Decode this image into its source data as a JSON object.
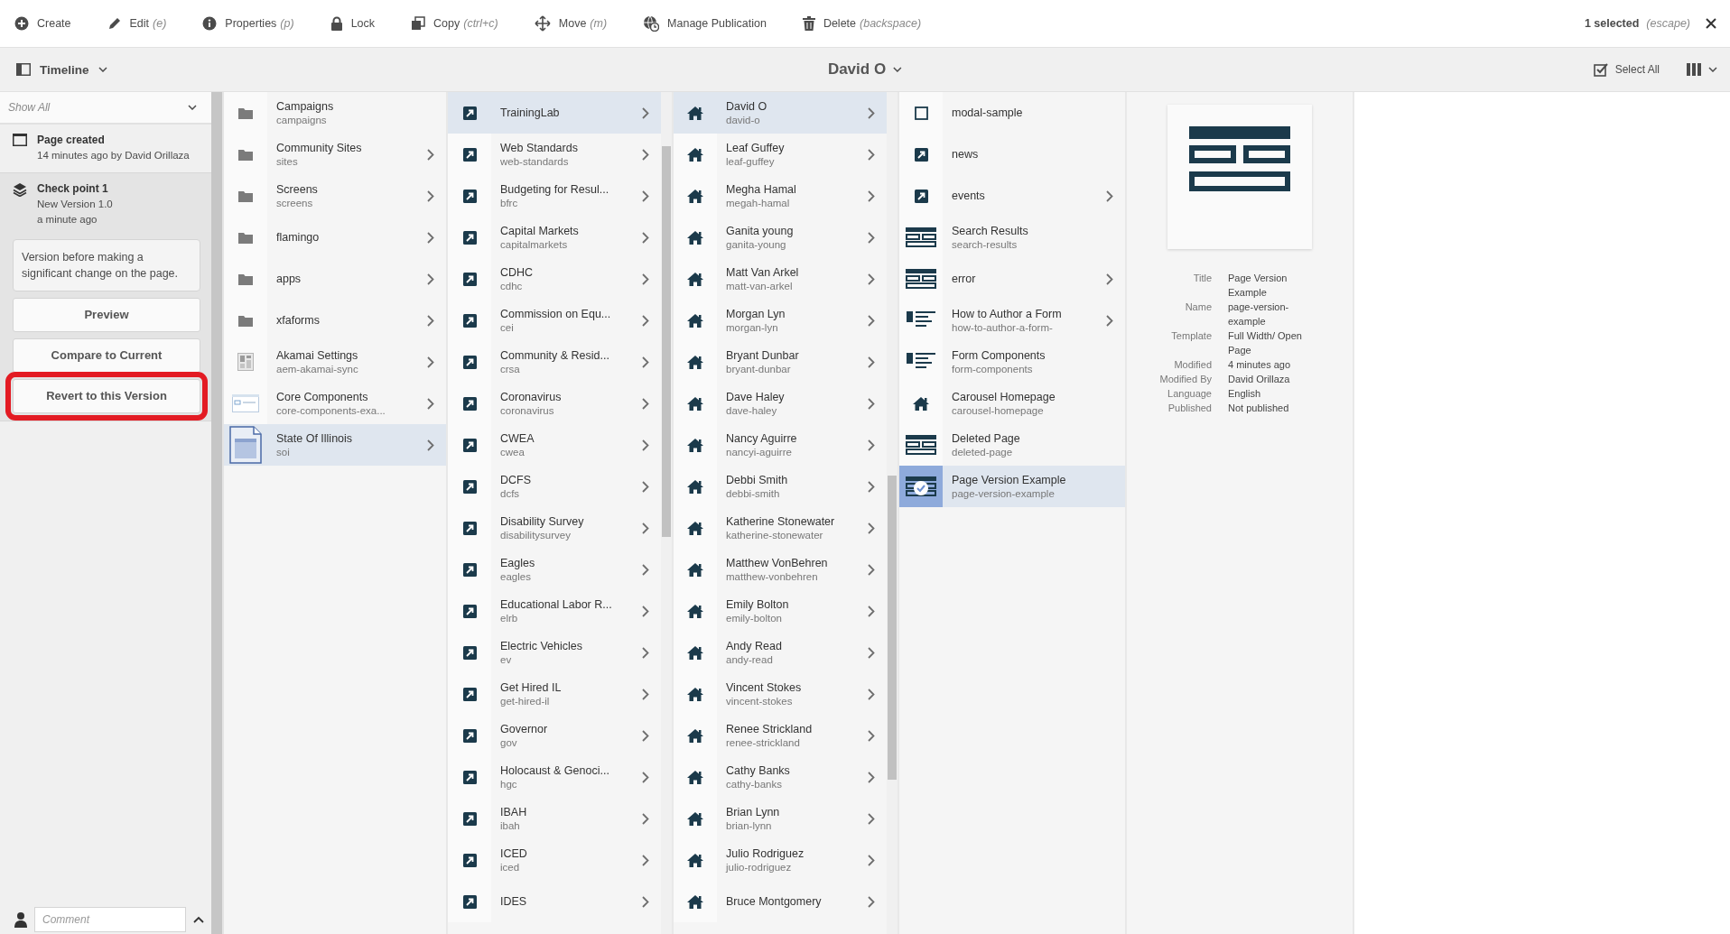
{
  "toolbar": {
    "actions": [
      {
        "kind": "create",
        "label": "Create"
      },
      {
        "kind": "edit",
        "label": "Edit",
        "shortcut": "(e)"
      },
      {
        "kind": "properties",
        "label": "Properties",
        "shortcut": "(p)"
      },
      {
        "kind": "lock",
        "label": "Lock"
      },
      {
        "kind": "copy",
        "label": "Copy",
        "shortcut": "(ctrl+c)"
      },
      {
        "kind": "move",
        "label": "Move",
        "shortcut": "(m)"
      },
      {
        "kind": "publication",
        "label": "Manage Publication"
      },
      {
        "kind": "delete",
        "label": "Delete",
        "shortcut": "(backspace)"
      }
    ],
    "selection": {
      "count": "1 selected",
      "shortcut": "(escape)"
    }
  },
  "subbar": {
    "rail": "Timeline",
    "title": "David O",
    "select_all": "Select All"
  },
  "timeline": {
    "filter": "Show All",
    "entries": [
      {
        "kind": "created",
        "title": "Page created",
        "lines": [
          "14 minutes ago by David Orillaza"
        ],
        "expanded": false
      },
      {
        "kind": "version",
        "title": "Check point 1",
        "lines": [
          "New Version 1.0",
          "a minute ago"
        ],
        "expanded": true,
        "comment": "Version before making a significant change on the page.",
        "actions": [
          {
            "label": "Preview",
            "highlighted": false
          },
          {
            "label": "Compare to Current",
            "highlighted": false
          },
          {
            "label": "Revert to this Version",
            "highlighted": true
          }
        ]
      }
    ],
    "comment_field": {
      "placeholder": "Comment"
    }
  },
  "columns": [
    {
      "items": [
        {
          "kind": "folder",
          "title": "Campaigns",
          "name": "campaigns",
          "has_children": false,
          "selected": false,
          "checked": false
        },
        {
          "kind": "folder",
          "title": "Community Sites",
          "name": "sites",
          "has_children": true,
          "selected": false,
          "checked": false
        },
        {
          "kind": "folder",
          "title": "Screens",
          "name": "screens",
          "has_children": true,
          "selected": false,
          "checked": false
        },
        {
          "kind": "folder",
          "title": "flamingo",
          "has_children": true,
          "selected": false,
          "checked": false
        },
        {
          "kind": "folder",
          "title": "apps",
          "has_children": true,
          "selected": false,
          "checked": false
        },
        {
          "kind": "folder",
          "title": "xfaforms",
          "has_children": true,
          "selected": false,
          "checked": false
        },
        {
          "kind": "settings",
          "title": "Akamai Settings",
          "name": "aem-akamai-sync",
          "has_children": true,
          "selected": false,
          "checked": false
        },
        {
          "kind": "card",
          "title": "Core Components",
          "name": "core-components-exa...",
          "has_children": true,
          "selected": false,
          "checked": false
        },
        {
          "kind": "page",
          "title": "State Of Illinois",
          "name": "soi",
          "has_children": true,
          "selected": true,
          "checked": false
        }
      ]
    },
    {
      "items": [
        {
          "kind": "link",
          "title": "TrainingLab",
          "has_children": true,
          "selected": true,
          "checked": false
        },
        {
          "kind": "link",
          "title": "Web Standards",
          "name": "web-standards",
          "has_children": true,
          "selected": false,
          "checked": false
        },
        {
          "kind": "link",
          "title": "Budgeting for Resul...",
          "name": "bfrc",
          "has_children": true,
          "selected": false,
          "checked": false
        },
        {
          "kind": "link",
          "title": "Capital Markets",
          "name": "capitalmarkets",
          "has_children": true,
          "selected": false,
          "checked": false
        },
        {
          "kind": "link",
          "title": "CDHC",
          "name": "cdhc",
          "has_children": true,
          "selected": false,
          "checked": false
        },
        {
          "kind": "link",
          "title": "Commission on Equ...",
          "name": "cei",
          "has_children": true,
          "selected": false,
          "checked": false
        },
        {
          "kind": "link",
          "title": "Community & Resid...",
          "name": "crsa",
          "has_children": true,
          "selected": false,
          "checked": false
        },
        {
          "kind": "link",
          "title": "Coronavirus",
          "name": "coronavirus",
          "has_children": true,
          "selected": false,
          "checked": false
        },
        {
          "kind": "link",
          "title": "CWEA",
          "name": "cwea",
          "has_children": true,
          "selected": false,
          "checked": false
        },
        {
          "kind": "link",
          "title": "DCFS",
          "name": "dcfs",
          "has_children": true,
          "selected": false,
          "checked": false
        },
        {
          "kind": "link",
          "title": "Disability Survey",
          "name": "disabilitysurvey",
          "has_children": true,
          "selected": false,
          "checked": false
        },
        {
          "kind": "link",
          "title": "Eagles",
          "name": "eagles",
          "has_children": true,
          "selected": false,
          "checked": false
        },
        {
          "kind": "link",
          "title": "Educational Labor R...",
          "name": "elrb",
          "has_children": true,
          "selected": false,
          "checked": false
        },
        {
          "kind": "link",
          "title": "Electric Vehicles",
          "name": "ev",
          "has_children": true,
          "selected": false,
          "checked": false
        },
        {
          "kind": "link",
          "title": "Get Hired IL",
          "name": "get-hired-il",
          "has_children": true,
          "selected": false,
          "checked": false
        },
        {
          "kind": "link",
          "title": "Governor",
          "name": "gov",
          "has_children": true,
          "selected": false,
          "checked": false
        },
        {
          "kind": "link",
          "title": "Holocaust & Genoci...",
          "name": "hgc",
          "has_children": true,
          "selected": false,
          "checked": false
        },
        {
          "kind": "link",
          "title": "IBAH",
          "name": "ibah",
          "has_children": true,
          "selected": false,
          "checked": false
        },
        {
          "kind": "link",
          "title": "ICED",
          "name": "iced",
          "has_children": true,
          "selected": false,
          "checked": false
        },
        {
          "kind": "link",
          "title": "IDES",
          "has_children": true,
          "selected": false,
          "checked": false
        }
      ]
    },
    {
      "items": [
        {
          "kind": "home",
          "title": "David O",
          "name": "david-o",
          "has_children": true,
          "selected": true,
          "checked": false
        },
        {
          "kind": "home",
          "title": "Leaf Guffey",
          "name": "leaf-guffey",
          "has_children": true,
          "selected": false,
          "checked": false
        },
        {
          "kind": "home",
          "title": "Megha Hamal",
          "name": "megah-hamal",
          "has_children": true,
          "selected": false,
          "checked": false
        },
        {
          "kind": "home",
          "title": "Ganita young",
          "name": "ganita-young",
          "has_children": true,
          "selected": false,
          "checked": false
        },
        {
          "kind": "home",
          "title": "Matt Van Arkel",
          "name": "matt-van-arkel",
          "has_children": true,
          "selected": false,
          "checked": false
        },
        {
          "kind": "home",
          "title": "Morgan Lyn",
          "name": "morgan-lyn",
          "has_children": true,
          "selected": false,
          "checked": false
        },
        {
          "kind": "home",
          "title": "Bryant Dunbar",
          "name": "bryant-dunbar",
          "has_children": true,
          "selected": false,
          "checked": false
        },
        {
          "kind": "home",
          "title": "Dave Haley",
          "name": "dave-haley",
          "has_children": true,
          "selected": false,
          "checked": false
        },
        {
          "kind": "home",
          "title": "Nancy Aguirre",
          "name": "nancyi-aguirre",
          "has_children": true,
          "selected": false,
          "checked": false
        },
        {
          "kind": "home",
          "title": "Debbi Smith",
          "name": "debbi-smith",
          "has_children": true,
          "selected": false,
          "checked": false
        },
        {
          "kind": "home",
          "title": "Katherine Stonewater",
          "name": "katherine-stonewater",
          "has_children": true,
          "selected": false,
          "checked": false
        },
        {
          "kind": "home",
          "title": "Matthew VonBehren",
          "name": "matthew-vonbehren",
          "has_children": true,
          "selected": false,
          "checked": false
        },
        {
          "kind": "home",
          "title": "Emily Bolton",
          "name": "emily-bolton",
          "has_children": true,
          "selected": false,
          "checked": false
        },
        {
          "kind": "home",
          "title": "Andy Read",
          "name": "andy-read",
          "has_children": true,
          "selected": false,
          "checked": false
        },
        {
          "kind": "home",
          "title": "Vincent Stokes",
          "name": "vincent-stokes",
          "has_children": true,
          "selected": false,
          "checked": false
        },
        {
          "kind": "home",
          "title": "Renee Strickland",
          "name": "renee-strickland",
          "has_children": true,
          "selected": false,
          "checked": false
        },
        {
          "kind": "home",
          "title": "Cathy Banks",
          "name": "cathy-banks",
          "has_children": true,
          "selected": false,
          "checked": false
        },
        {
          "kind": "home",
          "title": "Brian Lynn",
          "name": "brian-lynn",
          "has_children": true,
          "selected": false,
          "checked": false
        },
        {
          "kind": "home",
          "title": "Julio Rodriguez",
          "name": "julio-rodriguez",
          "has_children": true,
          "selected": false,
          "checked": false
        },
        {
          "kind": "home",
          "title": "Bruce Montgomery",
          "has_children": true,
          "selected": false,
          "checked": false
        }
      ]
    },
    {
      "items": [
        {
          "kind": "blank",
          "title": "modal-sample",
          "has_children": false,
          "selected": false,
          "checked": false
        },
        {
          "kind": "link",
          "title": "news",
          "has_children": false,
          "selected": false,
          "checked": false
        },
        {
          "kind": "link",
          "title": "events",
          "has_children": true,
          "selected": false,
          "checked": false
        },
        {
          "kind": "layout",
          "title": "Search Results",
          "name": "search-results",
          "has_children": false,
          "selected": false,
          "checked": false
        },
        {
          "kind": "layout",
          "title": "error",
          "has_children": true,
          "selected": false,
          "checked": false
        },
        {
          "kind": "form",
          "title": "How to Author a Form",
          "name": "how-to-author-a-form-",
          "has_children": true,
          "selected": false,
          "checked": false
        },
        {
          "kind": "form",
          "title": "Form Components",
          "name": "form-components",
          "has_children": false,
          "selected": false,
          "checked": false
        },
        {
          "kind": "home",
          "title": "Carousel Homepage",
          "name": "carousel-homepage",
          "has_children": false,
          "selected": false,
          "checked": false
        },
        {
          "kind": "layout",
          "title": "Deleted Page",
          "name": "deleted-page",
          "has_children": false,
          "selected": false,
          "checked": false
        },
        {
          "kind": "layout",
          "title": "Page Version Example",
          "name": "page-version-example",
          "has_children": false,
          "selected": true,
          "checked": true
        }
      ]
    }
  ],
  "details": {
    "properties": [
      {
        "label": "Title",
        "value": "Page Version Example"
      },
      {
        "label": "Name",
        "value": "page-version-example"
      },
      {
        "label": "Template",
        "value": "Full Width/ Open Page"
      },
      {
        "label": "Modified",
        "value": "4 minutes ago"
      },
      {
        "label": "Modified By",
        "value": "David Orillaza"
      },
      {
        "label": "Language",
        "value": "English"
      },
      {
        "label": "Published",
        "value": "Not published"
      }
    ]
  }
}
